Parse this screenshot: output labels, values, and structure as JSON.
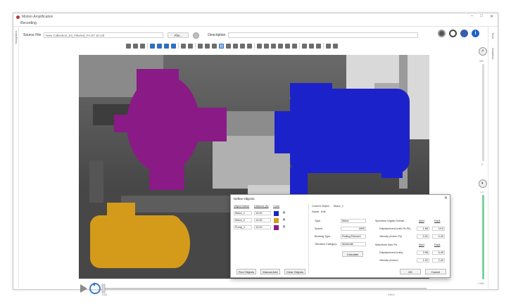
{
  "window": {
    "title": "Motion Amplification",
    "tab": "Recording",
    "left_rail_label": "Navigation",
    "right_rail_labels": [
      "Tools",
      "Workflow"
    ]
  },
  "source": {
    "label": "Source File",
    "value": "New Collection_04_Filtered_FA.67 10.cdr",
    "file_button": "File...",
    "description_label": "Description"
  },
  "icons": {
    "top_right": [
      "settings-gear-icon",
      "target-icon",
      "globe-icon",
      "info-icon"
    ],
    "colors": {
      "accent": "#2e6fc4",
      "info": "#1e63c7",
      "globe": "#3a5fa8"
    }
  },
  "viewer": {
    "objects_colors": {
      "pump": "#8a1a86",
      "motor": "#1c22c9",
      "motor2": "#d49b1a"
    }
  },
  "playbar": {
    "start_time": "0:00",
    "end_time": "0:00.4"
  },
  "right_panel": {
    "top_value": "100",
    "top_min": "0",
    "bottom_value": "1.4",
    "bottom_min": "1.00x"
  },
  "dialog": {
    "title": "Define Objects",
    "headers": {
      "name": "Object Name",
      "distance": "Distance (ft)",
      "color": "Color"
    },
    "objects": [
      {
        "name": "Motor_1",
        "distance": "10.00",
        "color": "#1c22c9"
      },
      {
        "name": "Motor_2",
        "distance": "12.00",
        "color": "#d49b1a"
      },
      {
        "name": "Pump_1",
        "distance": "10.00",
        "color": "#8a1a86"
      }
    ],
    "buttons": {
      "find": "Find Objects",
      "manual": "Manual Add",
      "clear": "Clear Objects",
      "ok": "OK",
      "cancel": "Cancel",
      "calculate": "Calculate"
    },
    "current": {
      "label": "Current Object",
      "value": "Motor_1",
      "name_label": "Name",
      "name_value": "Edit"
    },
    "fields": {
      "type_label": "Type",
      "type_value": "Motor",
      "speed_label": "Speed",
      "speed_value": "1800",
      "bearing_label": "Bearing Type",
      "bearing_value": "Rolling Element",
      "vibration_label": "Vibration Category",
      "vibration_value": "Moderate"
    },
    "spectrum": {
      "title": "Spectrum Digital Overall...",
      "col_alert": "Alert",
      "col_fault": "Fault",
      "rows": [
        {
          "label": "Displacement (mils Pk-Pk)",
          "alert": "1.65",
          "fault": "10.0"
        },
        {
          "label": "Velocity (in/sec Pk)",
          "alert": "0.31",
          "fault": "0.42"
        }
      ]
    },
    "waveform": {
      "title": "Waveform Max Pk-",
      "col_alert": "Alert",
      "col_fault": "Fault",
      "rows": [
        {
          "label": "Displacement (mils)",
          "alert": "3.96",
          "fault": "6.40"
        },
        {
          "label": "Velocity (in/sec)",
          "alert": "1.22",
          "fault": "2.42"
        }
      ]
    }
  }
}
